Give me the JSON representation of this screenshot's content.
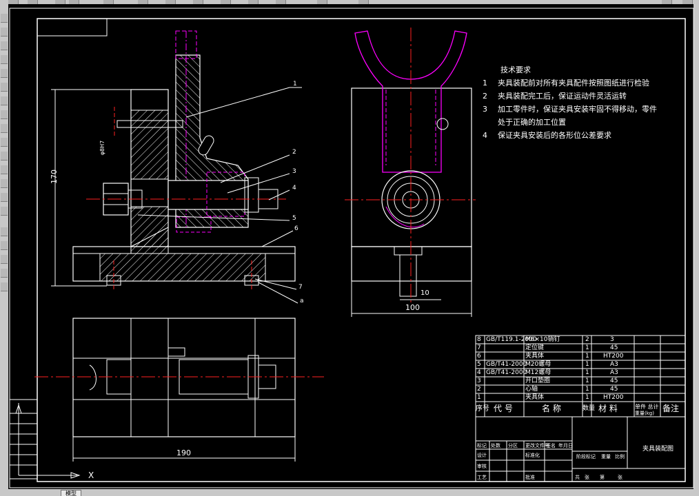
{
  "window": {
    "model_tab": "模型"
  },
  "technical_requirements": {
    "heading": "技术要求",
    "items": [
      {
        "num": "1",
        "text": "夹具装配前对所有夹具配件按照图纸进行检验"
      },
      {
        "num": "2",
        "text": "夹具装配完工后，保证运动件灵活运转"
      },
      {
        "num": "3",
        "text": "加工零件时，保证夹具安装牢固不得移动，零件"
      },
      {
        "num": "",
        "text": "处于正确的加工位置"
      },
      {
        "num": "4",
        "text": "保证夹具安装后的各形位公差要求"
      }
    ]
  },
  "dimensions": {
    "height_170": "170",
    "width_100": "100",
    "width_190": "190",
    "fit_h7": "φ8H7",
    "fit_10": "10"
  },
  "callouts": [
    "1",
    "2",
    "3",
    "4",
    "5",
    "6",
    "7",
    "a"
  ],
  "bom": {
    "rows": [
      {
        "no": "8",
        "code": "GB/T119.1-2000",
        "name": "M6×10销钉",
        "qty": "2",
        "material": "3",
        "note": ""
      },
      {
        "no": "7",
        "code": "",
        "name": "定位键",
        "qty": "1",
        "material": "45",
        "note": ""
      },
      {
        "no": "6",
        "code": "",
        "name": "夹具体",
        "qty": "1",
        "material": "HT200",
        "note": ""
      },
      {
        "no": "5",
        "code": "GB/T41-2000",
        "name": "M20螺母",
        "qty": "1",
        "material": "A3",
        "note": ""
      },
      {
        "no": "4",
        "code": "GB/T41-2000",
        "name": "M12螺母",
        "qty": "1",
        "material": "A3",
        "note": ""
      },
      {
        "no": "3",
        "code": "",
        "name": "开口垫圈",
        "qty": "1",
        "material": "45",
        "note": ""
      },
      {
        "no": "2",
        "code": "",
        "name": "心轴",
        "qty": "1",
        "material": "45",
        "note": ""
      },
      {
        "no": "1",
        "code": "",
        "name": "夹具体",
        "qty": "1",
        "material": "HT200",
        "note": ""
      }
    ],
    "header": {
      "no": "序号",
      "code": "代  号",
      "name": "名  称",
      "qty": "数量",
      "material": "材  料",
      "weight": "单件 总计",
      "weight2": "重量(kg)",
      "note": "备注"
    }
  },
  "title_block": {
    "drawing_name": "夹具装配图",
    "labels": [
      "标记",
      "处数",
      "分区",
      "更改文件号",
      "签名",
      "年月日",
      "设计",
      "标准化",
      "审核",
      "工艺",
      "批准",
      "阶段标记",
      "重量",
      "比例",
      "共",
      "张",
      "第",
      "张"
    ]
  },
  "ucs": {
    "x_label": "X"
  },
  "colors": {
    "background": "#000000",
    "geometry": "#ffffff",
    "centerline": "#ff2020",
    "magenta": "#ff00ff",
    "hatch": "#ffffff"
  }
}
